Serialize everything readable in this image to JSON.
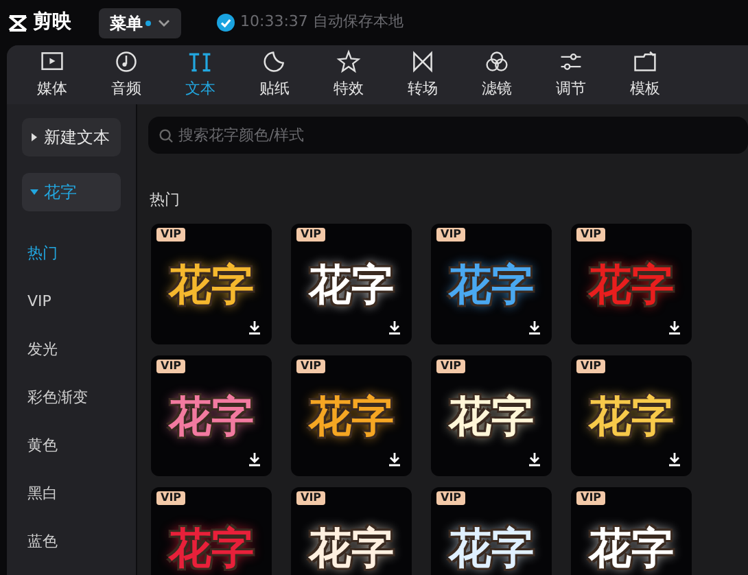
{
  "app": {
    "logo": "剪映",
    "menu": {
      "label": "菜单",
      "unread": true
    },
    "save_status": "10:33:37 自动保存本地"
  },
  "tabs": [
    {
      "label": "媒体",
      "selected": false
    },
    {
      "label": "音频",
      "selected": false
    },
    {
      "label": "文本",
      "selected": true
    },
    {
      "label": "贴纸",
      "selected": false
    },
    {
      "label": "特效",
      "selected": false
    },
    {
      "label": "转场",
      "selected": false
    },
    {
      "label": "滤镜",
      "selected": false
    },
    {
      "label": "调节",
      "selected": false
    },
    {
      "label": "模板",
      "selected": false
    }
  ],
  "sidebar": {
    "groups": [
      {
        "label": "新建文本",
        "expanded": false,
        "selected": false
      },
      {
        "label": "花字",
        "expanded": true,
        "selected": true,
        "children": [
          {
            "label": "热门",
            "selected": true
          },
          {
            "label": "VIP",
            "selected": false
          },
          {
            "label": "发光",
            "selected": false
          },
          {
            "label": "彩色渐变",
            "selected": false
          },
          {
            "label": "黄色",
            "selected": false
          },
          {
            "label": "黑白",
            "selected": false
          },
          {
            "label": "蓝色",
            "selected": false
          }
        ]
      }
    ]
  },
  "search": {
    "placeholder": "搜索花字颜色/样式"
  },
  "section": {
    "title": "热门",
    "cards": [
      {
        "badge": "VIP",
        "sample": "花字",
        "color": "#f5b82e"
      },
      {
        "badge": "VIP",
        "sample": "花字",
        "color": "#ffffff"
      },
      {
        "badge": "VIP",
        "sample": "花字",
        "color": "#4aa8f0"
      },
      {
        "badge": "VIP",
        "sample": "花字",
        "color": "#e81e1e"
      },
      {
        "badge": "VIP",
        "sample": "花字",
        "color": "#f27aa0"
      },
      {
        "badge": "VIP",
        "sample": "花字",
        "color": "#f5a623"
      },
      {
        "badge": "VIP",
        "sample": "花字",
        "color": "#fff6d8"
      },
      {
        "badge": "VIP",
        "sample": "花字",
        "color": "#f7c94a"
      },
      {
        "badge": "VIP",
        "sample": "花字",
        "color": "#e8203a"
      },
      {
        "badge": "VIP",
        "sample": "花字",
        "color": "#fff0e0"
      },
      {
        "badge": "VIP",
        "sample": "花字",
        "color": "#e0f0ff"
      },
      {
        "badge": "VIP",
        "sample": "花字",
        "color": "#ffffff"
      }
    ]
  }
}
